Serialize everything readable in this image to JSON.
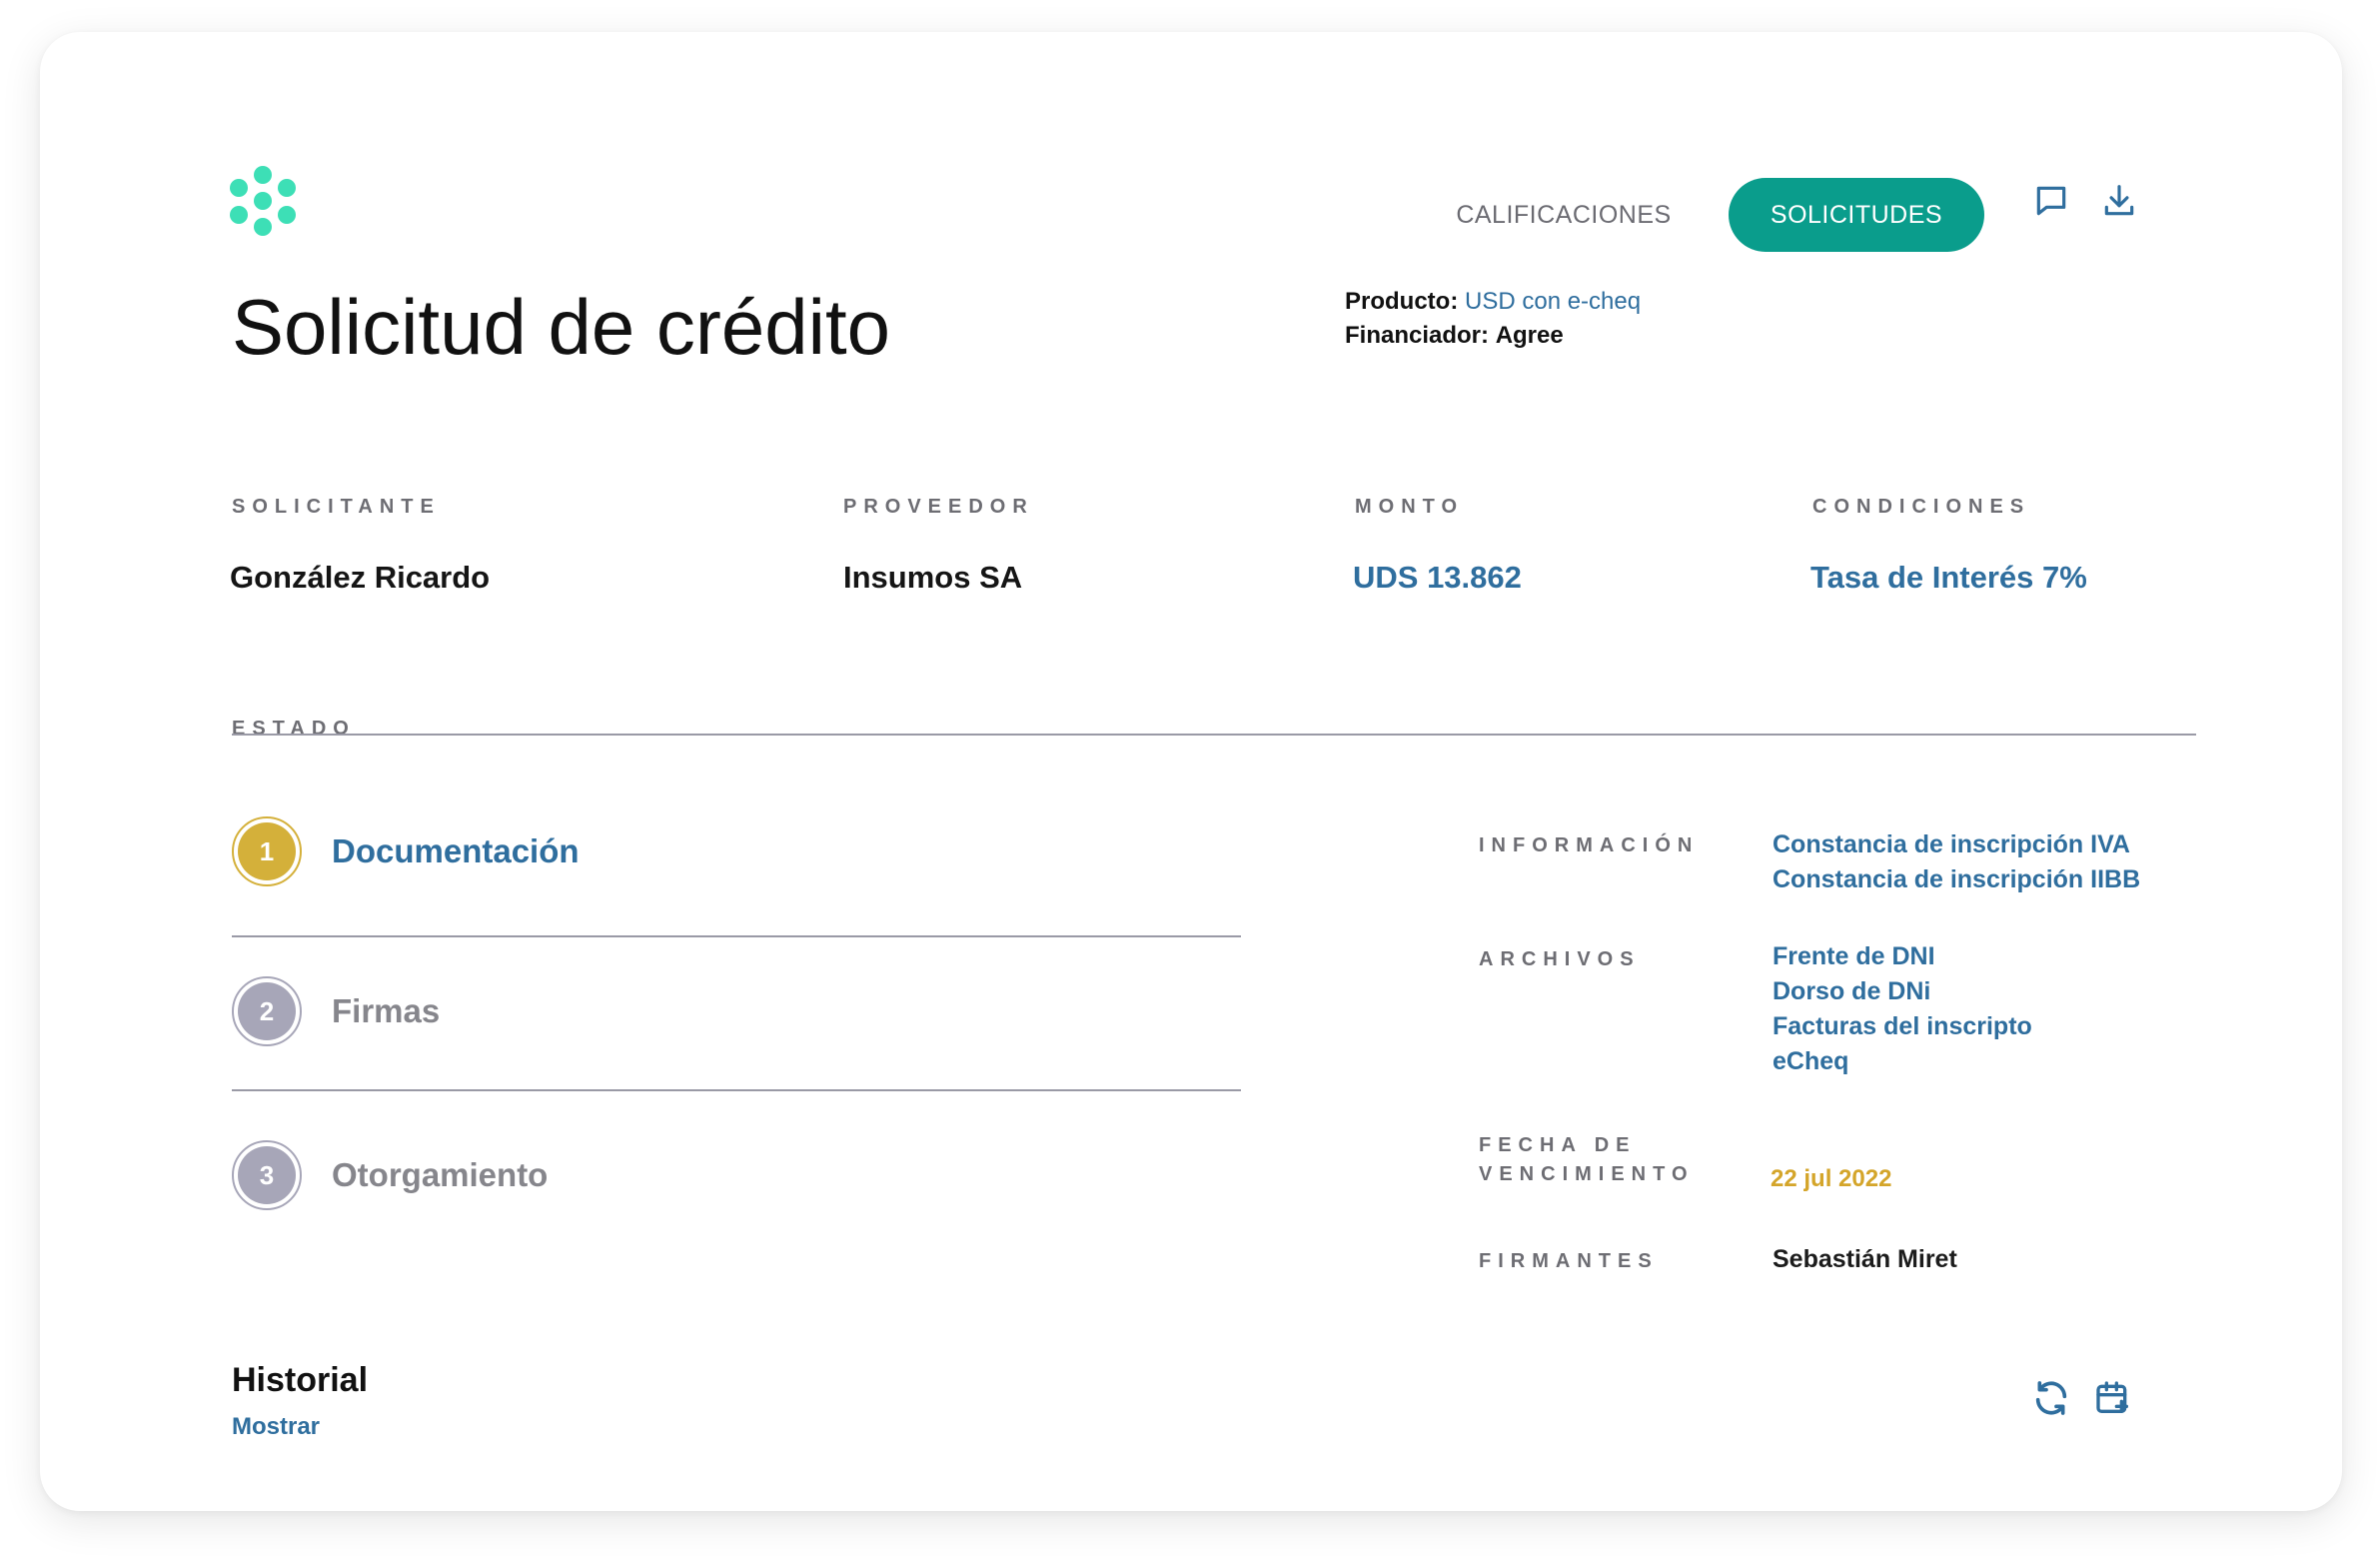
{
  "header": {
    "tabs": [
      {
        "label": "CALIFICACIONES",
        "active": false
      },
      {
        "label": "SOLICITUDES",
        "active": true
      }
    ],
    "icons": [
      "chat-icon",
      "download-icon"
    ],
    "colors": {
      "brand": "#3ddfb6",
      "active_tab": "#0a9d8c"
    }
  },
  "page": {
    "title": "Solicitud de crédito",
    "producto_label": "Producto:",
    "producto_value": "USD con e-cheq",
    "financiador_label": "Financiador:",
    "financiador_value": "Agree"
  },
  "summary": [
    {
      "label": "SOLICITANTE",
      "value": "González Ricardo"
    },
    {
      "label": "PROVEEDOR",
      "value": "Insumos SA"
    },
    {
      "label": "MONTO",
      "value": "UDS 13.862"
    },
    {
      "label": "CONDICIONES",
      "value": "Tasa de Interés 7%"
    }
  ],
  "estado": {
    "label": "ESTADO",
    "steps": [
      {
        "number": "1",
        "label": "Documentación",
        "state": "current",
        "color": "#d4b03a"
      },
      {
        "number": "2",
        "label": "Firmas",
        "state": "pending",
        "color": "#a7a6b8"
      },
      {
        "number": "3",
        "label": "Otorgamiento",
        "state": "pending",
        "color": "#a7a6b8"
      }
    ]
  },
  "details": {
    "informacion": {
      "label": "INFORMACIÓN",
      "items": [
        "Constancia de inscripción IVA",
        "Constancia de inscripción IIBB"
      ]
    },
    "archivos": {
      "label": "ARCHIVOS",
      "items": [
        "Frente de DNI",
        "Dorso de DNi",
        "Facturas del inscripto",
        "eCheq"
      ]
    },
    "vencimiento": {
      "label_line1": "FECHA DE",
      "label_line2": "VENCIMIENTO",
      "value": "22 jul 2022"
    },
    "firmantes": {
      "label": "FIRMANTES",
      "value": "Sebastián Miret"
    }
  },
  "historial": {
    "title": "Historial",
    "link": "Mostrar"
  },
  "footer_icons": [
    "refresh-icon",
    "calendar-add-icon"
  ]
}
